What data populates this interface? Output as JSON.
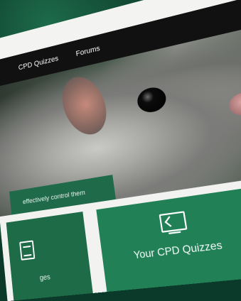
{
  "nav": {
    "items": [
      "CPD Quizzes",
      "Forums"
    ]
  },
  "hero": {
    "caption": "effectively control them"
  },
  "tiles": [
    {
      "title": "Your CPD Quizzes"
    },
    {
      "title": "",
      "partial": "ges"
    }
  ]
}
